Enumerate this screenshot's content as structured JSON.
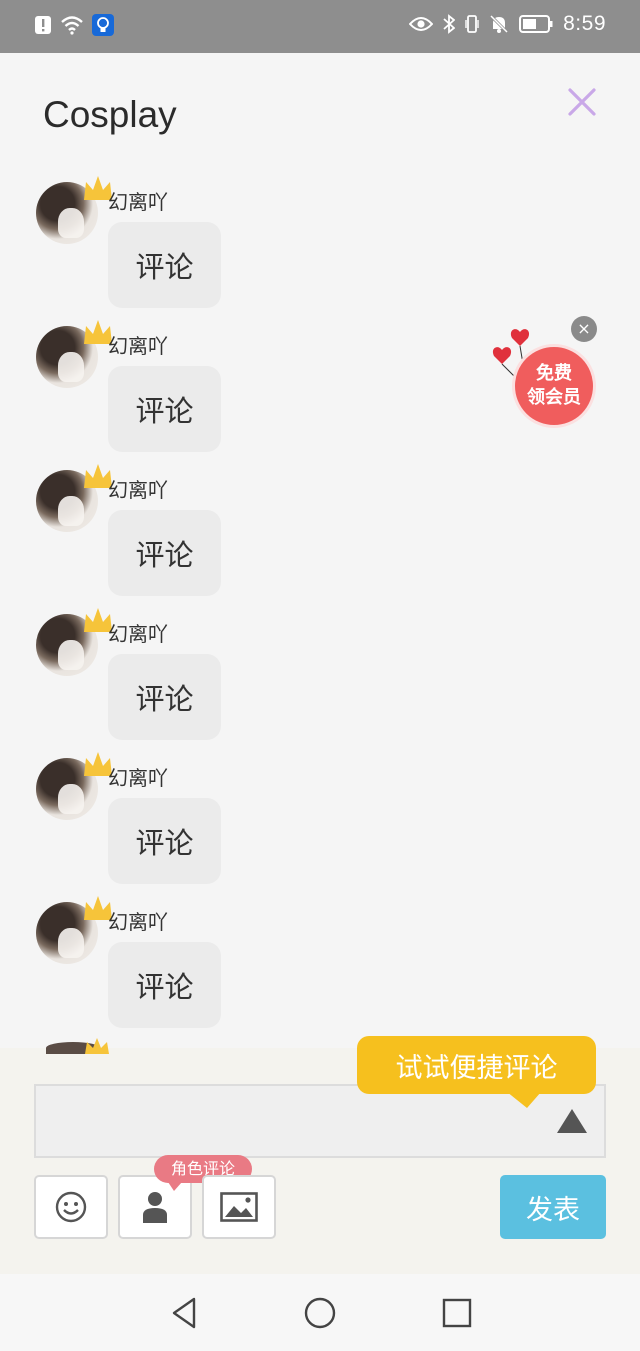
{
  "status_bar": {
    "time": "8:59",
    "left_icons": [
      "alert-icon",
      "wifi-icon",
      "lightbulb-icon"
    ],
    "right_icons": [
      "eye-icon",
      "bluetooth-icon",
      "vibrate-icon",
      "mute-icon",
      "battery-icon"
    ]
  },
  "header": {
    "title": "Cosplay",
    "close_icon": "close-icon",
    "accent_color": "#c9a8e8"
  },
  "comments": [
    {
      "username": "幻离吖",
      "text": "评论"
    },
    {
      "username": "幻离吖",
      "text": "评论"
    },
    {
      "username": "幻离吖",
      "text": "评论"
    },
    {
      "username": "幻离吖",
      "text": "评论"
    },
    {
      "username": "幻离吖",
      "text": "评论"
    },
    {
      "username": "幻离吖",
      "text": "评论"
    }
  ],
  "vip_badge": {
    "line1": "免费",
    "line2": "领会员",
    "close": "×"
  },
  "compose": {
    "tip": "试试便捷评论",
    "input_value": "",
    "input_placeholder": "",
    "role_tag": "角色评论",
    "publish": "发表",
    "tools": [
      "emoji-icon",
      "person-icon",
      "image-icon"
    ]
  },
  "nav": {
    "buttons": [
      "back-icon",
      "home-icon",
      "recents-icon"
    ]
  },
  "colors": {
    "tip": "#f6c01e",
    "publish": "#5bc0e0",
    "role_tag": "#e97a84",
    "vip": "#f05d5d"
  }
}
